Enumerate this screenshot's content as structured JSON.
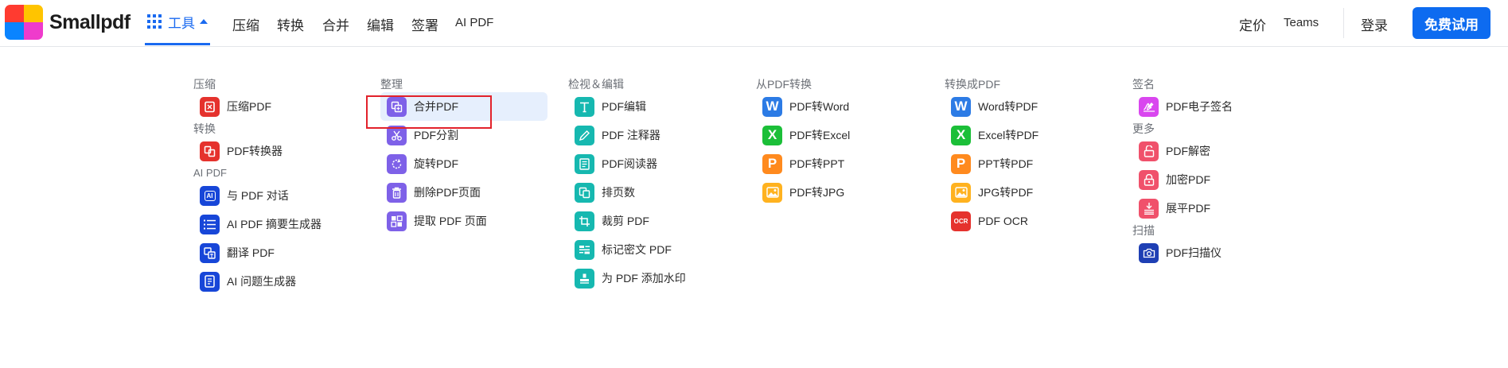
{
  "header": {
    "logo_text": "Smallpdf",
    "tools_label": "工具",
    "nav": [
      "压缩",
      "转换",
      "合并",
      "编辑",
      "签署",
      "AI PDF"
    ],
    "pricing": "定价",
    "teams": "Teams",
    "login": "登录",
    "cta": "免费试用"
  },
  "menu": {
    "compress": {
      "title": "压缩",
      "items": [
        "压缩PDF"
      ]
    },
    "convert": {
      "title": "转换",
      "items": [
        "PDF转换器"
      ]
    },
    "ai": {
      "title": "AI PDF",
      "items": [
        "与 PDF 对话",
        "AI PDF 摘要生成器",
        "翻译 PDF",
        "AI 问题生成器"
      ]
    },
    "organize": {
      "title": "整理",
      "items": [
        "合并PDF",
        "PDF分割",
        "旋转PDF",
        "删除PDF页面",
        "提取 PDF 页面"
      ]
    },
    "view_edit": {
      "title": "检视＆编辑",
      "items": [
        "PDF编辑",
        "PDF 注释器",
        "PDF阅读器",
        "排页数",
        "裁剪 PDF",
        "标记密文 PDF",
        "为 PDF 添加水印"
      ]
    },
    "from_pdf": {
      "title": "从PDF转换",
      "items": [
        "PDF转Word",
        "PDF转Excel",
        "PDF转PPT",
        "PDF转JPG"
      ]
    },
    "to_pdf": {
      "title": "转换成PDF",
      "items": [
        "Word转PDF",
        "Excel转PDF",
        "PPT转PDF",
        "JPG转PDF",
        "PDF OCR"
      ]
    },
    "sign": {
      "title": "签名",
      "items": [
        "PDF电子签名"
      ]
    },
    "more": {
      "title": "更多",
      "items": [
        "PDF解密",
        "加密PDF",
        "展平PDF"
      ]
    },
    "scan": {
      "title": "扫描",
      "items": [
        "PDF扫描仪"
      ]
    }
  },
  "icons": {
    "word_glyph": "W",
    "excel_glyph": "X",
    "ppt_glyph": "P",
    "ocr_glyph": "OCR",
    "ai_glyph": "AI"
  },
  "colors": {
    "brand_blue": "#0d6bf0",
    "compress_red": "#e5322d",
    "organize_purple": "#7e61e8",
    "edit_teal": "#16b8b0",
    "word_blue": "#2c7be5",
    "excel_green": "#1bbf38",
    "ppt_orange": "#ff8a1e",
    "jpg_yellow": "#ffb21f",
    "sign_pink": "#d946ef",
    "more_rose": "#f0516b",
    "scan_navy": "#1e3fb4",
    "ai_navy": "#1746d8",
    "highlight_red": "#e2222b"
  }
}
